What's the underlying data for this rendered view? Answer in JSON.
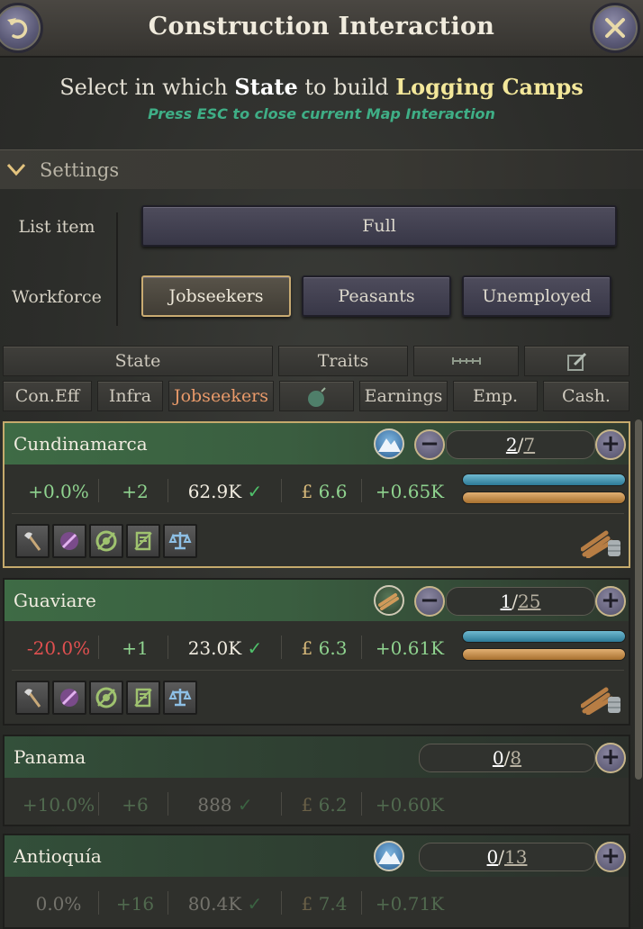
{
  "header": {
    "title": "Construction Interaction"
  },
  "instruction": {
    "prefix": "Select in which",
    "state": "State",
    "middle": "to build",
    "building": "Logging Camps"
  },
  "hint": "Press ESC to close current Map Interaction",
  "settings": {
    "label": "Settings",
    "list_item_label": "List item",
    "list_item_value": "Full",
    "workforce_label": "Workforce",
    "workforce_options": [
      "Jobseekers",
      "Peasants",
      "Unemployed"
    ],
    "workforce_selected": "Jobseekers"
  },
  "columns_row1": [
    "State",
    "Traits",
    "",
    ""
  ],
  "columns_row2": [
    "Con.Eff",
    "Infra",
    "Jobseekers",
    "",
    "Earnings",
    "Emp.",
    "Cash."
  ],
  "columns_active": "Jobseekers",
  "rows": [
    {
      "name": "Cundinamarca",
      "icon": "mountain-icon",
      "built": "2",
      "max": "7",
      "con_eff": "+0.0%",
      "infra": "+2",
      "jobseekers": "62.9K",
      "currency": "£",
      "earnings": "6.6",
      "cash": "+0.65K",
      "selected": true
    },
    {
      "name": "Guaviare",
      "icon": "wood-icon",
      "built": "1",
      "max": "25",
      "con_eff": "-20.0%",
      "infra": "+1",
      "jobseekers": "23.0K",
      "currency": "£",
      "earnings": "6.3",
      "cash": "+0.61K"
    },
    {
      "name": "Panama",
      "built": "0",
      "max": "8",
      "con_eff": "+10.0%",
      "infra": "+6",
      "jobseekers": "888",
      "currency": "£",
      "earnings": "6.2",
      "cash": "+0.60K"
    },
    {
      "name": "Antioquía",
      "icon": "mountain-icon",
      "built": "0",
      "max": "13",
      "con_eff": "0.0%",
      "infra": "+16",
      "jobseekers": "80.4K",
      "currency": "£",
      "earnings": "7.4",
      "cash": "+0.71K"
    }
  ],
  "colors": {
    "accent_gold": "#c5aa6c",
    "green": "#8fd38f",
    "red": "#e05050",
    "hint": "#3fae86",
    "building": "#f3e79a"
  }
}
